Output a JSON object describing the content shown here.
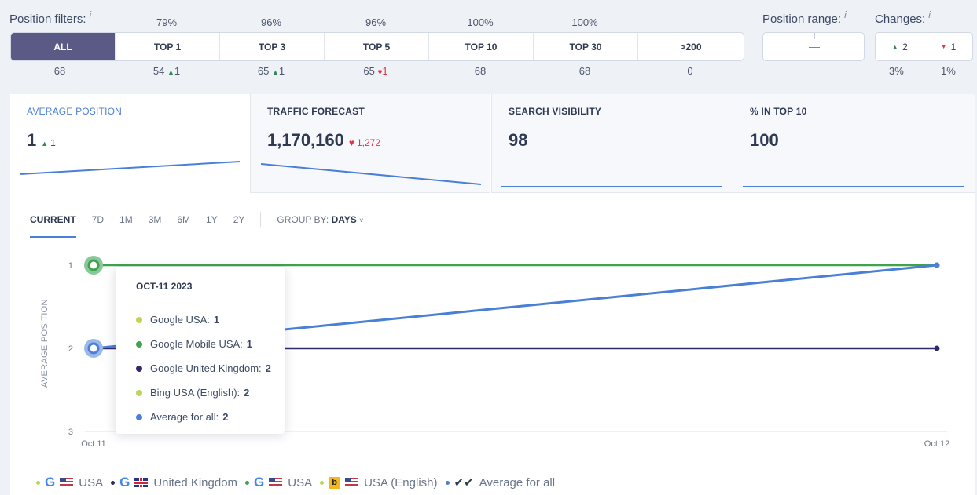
{
  "filters": {
    "title": "Position filters:",
    "info": "i",
    "buttons": [
      {
        "label": "ALL",
        "pct": "",
        "count": "68",
        "delta": "",
        "dir": ""
      },
      {
        "label": "TOP 1",
        "pct": "79%",
        "count": "54",
        "delta": "1",
        "dir": "up"
      },
      {
        "label": "TOP 3",
        "pct": "96%",
        "count": "65",
        "delta": "1",
        "dir": "up"
      },
      {
        "label": "TOP 5",
        "pct": "96%",
        "count": "65",
        "delta": "1",
        "dir": "down"
      },
      {
        "label": "TOP 10",
        "pct": "100%",
        "count": "68",
        "delta": "",
        "dir": ""
      },
      {
        "label": "TOP 30",
        "pct": "100%",
        "count": "68",
        "delta": "",
        "dir": ""
      },
      {
        "label": ">200",
        "pct": "",
        "count": "0",
        "delta": "",
        "dir": ""
      }
    ]
  },
  "range": {
    "title": "Position range:",
    "info": "i"
  },
  "changes": {
    "title": "Changes:",
    "info": "i",
    "up": "2",
    "down": "1",
    "up_pct": "3%",
    "down_pct": "1%"
  },
  "metrics": [
    {
      "title": "AVERAGE POSITION",
      "value": "1",
      "delta": "1",
      "dir": "up"
    },
    {
      "title": "TRAFFIC FORECAST",
      "value": "1,170,160",
      "delta": "1,272",
      "dir": "down"
    },
    {
      "title": "SEARCH VISIBILITY",
      "value": "98",
      "delta": "",
      "dir": ""
    },
    {
      "title": "% IN TOP 10",
      "value": "100",
      "delta": "",
      "dir": ""
    }
  ],
  "tabs": [
    "CURRENT",
    "7D",
    "1M",
    "3M",
    "6M",
    "1Y",
    "2Y"
  ],
  "group_by": {
    "label": "GROUP BY:",
    "value": "DAYS"
  },
  "chart_data": {
    "type": "line",
    "ylabel": "AVERAGE POSITION",
    "y_ticks": [
      "1",
      "2",
      "3"
    ],
    "ylim": [
      3,
      1
    ],
    "x": [
      "Oct 11",
      "Oct 12"
    ],
    "series": [
      {
        "color": "#3fa34d",
        "values": [
          1,
          1
        ]
      },
      {
        "color": "#2e2a6b",
        "values": [
          2,
          2
        ]
      },
      {
        "color": "#4a7fd6",
        "values": [
          2,
          1
        ]
      }
    ]
  },
  "tooltip": {
    "title": "OCT-11 2023",
    "rows": [
      {
        "name": "Google USA:",
        "value": "1",
        "color": "#bcd65a"
      },
      {
        "name": "Google Mobile USA:",
        "value": "1",
        "color": "#3fa34d"
      },
      {
        "name": "Google United Kingdom:",
        "value": "2",
        "color": "#2e2a6b"
      },
      {
        "name": "Bing USA (English):",
        "value": "2",
        "color": "#bcd65a"
      },
      {
        "name": "Average for all:",
        "value": "2",
        "color": "#4a7fd6"
      }
    ]
  },
  "legend": [
    {
      "engine": "google-icon",
      "flag": "us-flag-icon",
      "label": "USA",
      "color": "#bcd65a"
    },
    {
      "engine": "google-icon",
      "flag": "uk-flag-icon",
      "label": "United Kingdom",
      "color": "#2e2a6b"
    },
    {
      "engine": "google-mobile-icon",
      "flag": "us-flag-icon",
      "label": "USA",
      "color": "#3fa34d"
    },
    {
      "engine": "bing-icon",
      "flag": "us-flag-icon",
      "label": "USA (English)",
      "color": "#bcd65a"
    },
    {
      "engine": "average-icon",
      "flag": "",
      "label": "Average for all",
      "color": "#4a7fd6"
    }
  ]
}
